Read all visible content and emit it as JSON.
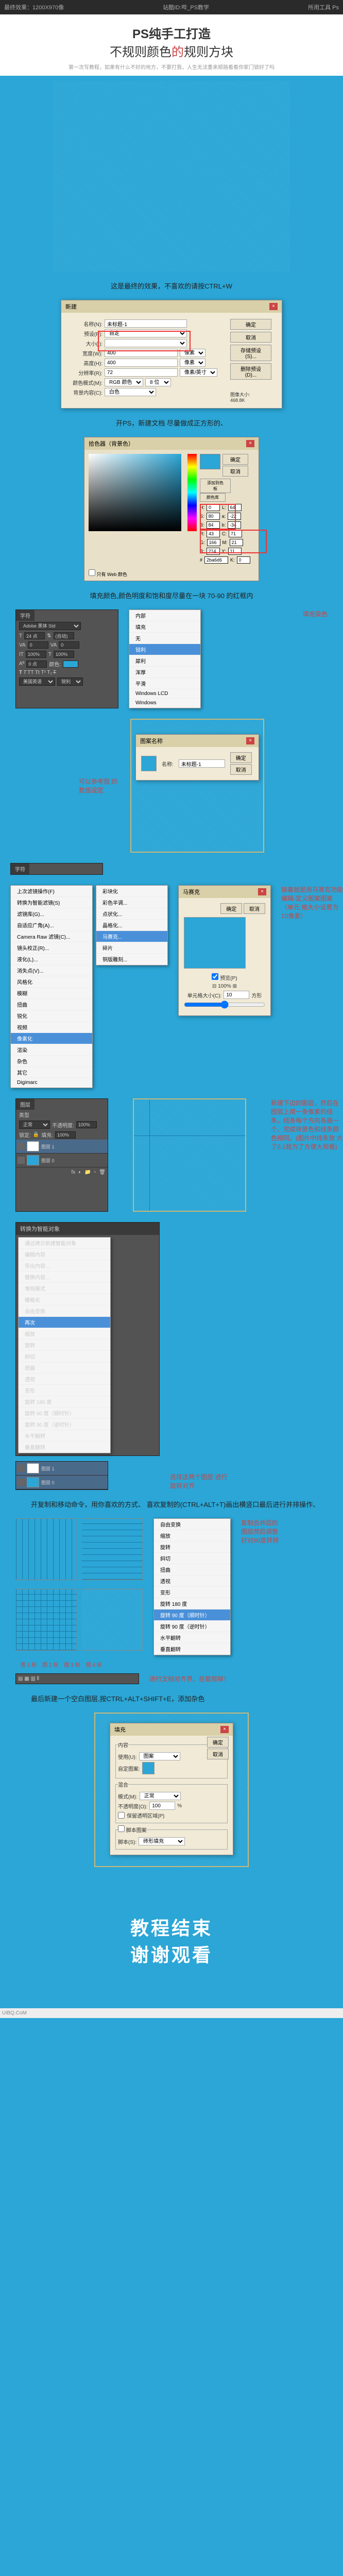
{
  "header": {
    "left": "最终效果：1200X970像",
    "mid": "站酷ID:哔_PS教学",
    "right": "所用工具 Ps"
  },
  "title": {
    "main": "PS纯手工打造",
    "sub1": "不规则颜色",
    "red": "的",
    "sub2": "规则方块",
    "note": "第一次写教程，如果有什么不好的地方，不要打我，人生无法重来顺路看看你家门锁好了吗"
  },
  "step1": {
    "caption": "这是最终的效果，不喜欢的请按CTRL+W"
  },
  "newdoc": {
    "title": "新建",
    "name_label": "名称(N):",
    "name_val": "未标题-1",
    "preset_label": "预设(P):",
    "preset_val": "自定",
    "size_label": "大小(I):",
    "width_label": "宽度(W):",
    "width_val": "400",
    "width_unit": "像素",
    "height_label": "高度(H):",
    "height_val": "400",
    "height_unit": "像素",
    "res_label": "分辨率(R):",
    "res_val": "72",
    "res_unit": "像素/英寸",
    "mode_label": "颜色模式(M):",
    "mode_val": "RGB 颜色",
    "bit": "8 位",
    "bg_label": "背景内容(C):",
    "bg_val": "白色",
    "ok": "确定",
    "cancel": "取消",
    "save": "存储预设(S)...",
    "del": "删除预设(D)...",
    "imgsize": "图像大小:",
    "imgsize_val": "468.8K"
  },
  "step2": {
    "caption": "开PS，新建文档 尽量做成正方形的、"
  },
  "picker": {
    "title": "拾色器（背景色）",
    "new": "新的",
    "cur": "当前",
    "only_web": "只有 Web 颜色",
    "ok": "确定",
    "cancel": "取消",
    "addlib": "添加到色板",
    "lib": "颜色库",
    "H": "H:",
    "Hv": "0",
    "S": "S:",
    "Sv": "80",
    "B": "B:",
    "Bv": "84",
    "Rl": "R:",
    "Rv": "43",
    "Gl": "G:",
    "Gv": "166",
    "b": "B:",
    "bv": "214",
    "L": "L:",
    "Lv": "64",
    "a": "a:",
    "av": "-22",
    "bb": "b:",
    "bbv": "-34",
    "hex": "#",
    "hexv": "2ba6d6",
    "C": "C:",
    "Cv": "71",
    "M": "M:",
    "Mv": "21",
    "Y": "Y:",
    "Yv": "11",
    "K": "K:",
    "Kv": "0"
  },
  "step3": {
    "caption": "填充颜色,颜色明度和饱和度尽量在一块 70-90 的红框内"
  },
  "fill_label": "填充染色",
  "char_panel": {
    "tab": "字符",
    "font": "Adobe 黑体 Std",
    "size": "24 点",
    "leading": "(自动)",
    "tracking": "0",
    "vscale": "100%",
    "hscale": "100%",
    "baseline": "0 点",
    "color": "颜色:",
    "lang": "美国英语",
    "aa": "锐利"
  },
  "menu_blend": {
    "items": [
      "内部",
      "填充",
      "无",
      "锐利",
      "犀利",
      "浑厚",
      "平滑",
      "Windows LCD",
      "Windows"
    ]
  },
  "step4": {
    "caption": "可以参考我\n的数值设定"
  },
  "pattern": {
    "title": "图案名称",
    "name_label": "名称:",
    "name_val": "未标题-1",
    "ok": "确定",
    "cancel": "取消"
  },
  "step5": {
    "caption": "接着就是用马赛克功能\n编辑-定义图案图案（单元\n格大小设置为10像素）"
  },
  "filters": {
    "items": [
      "上次滤镜操作(F)",
      "转换为智能滤镜(S)",
      "滤镜库(G)...",
      "自适应广角(A)...",
      "Camera Raw 滤镜(C)...",
      "镜头校正(R)...",
      "液化(L)...",
      "消失点(V)...",
      "风格化",
      "模糊",
      "扭曲",
      "锐化",
      "视频",
      "像素化",
      "渲染",
      "杂色",
      "其它",
      "Digimarc"
    ],
    "sub": [
      "彩块化",
      "彩色半调...",
      "点状化...",
      "晶格化...",
      "马赛克...",
      "碎片",
      "铜版雕刻..."
    ]
  },
  "mosaic": {
    "title": "马赛克",
    "ok": "确定",
    "cancel": "取消",
    "preview": "预览(P)",
    "cell": "单元格大小(C):",
    "cellv": "10",
    "unit": "方形"
  },
  "layers_panel": {
    "tab": "图层",
    "kind": "类型",
    "mode": "正常",
    "opacity_l": "不透明度:",
    "opacity": "100%",
    "lock": "锁定:",
    "fill_l": "填充:",
    "fill": "100%",
    "l1": "图层 1",
    "l0": "图层 0"
  },
  "step6": {
    "caption": "新建下边的图层，然后在\n图层上用一条像素的线\n条，线条每个方向各画一\n个、完成背景色和线条颜\n色相同。(图片中线条放\n大了0.1我为了方便大观看)"
  },
  "move_dialog": {
    "title": "转换为智能对象",
    "dup": "通过拷贝新建智能对象",
    "edit": "编辑内容",
    "exp": "导出内容...",
    "rep": "替换内容...",
    "stack": "堆栈模式",
    "rast": "栅格化",
    "free": "自由变换",
    "again": "再次",
    "scale": "缩放",
    "rot": "旋转",
    "skew": "斜切",
    "dist": "扭曲",
    "persp": "透视",
    "warp": "变形",
    "r180": "旋转 180 度",
    "r90cw": "旋转 90 度（顺时针）",
    "r90ccw": "旋转 90 度（逆时针）",
    "flipH": "水平翻转",
    "flipV": "垂直翻转"
  },
  "step7": {
    "caption": "选择这两个图层\n进行旋转对齐"
  },
  "step8": {
    "caption": "开复制和移动命令，用你喜欢的方式、\n喜欢复制的(CTRL+ALT+T)画出横竖口最后进行并排操作、"
  },
  "step9": {
    "caption": "复制合并后的\n图层然后调整\n好对90度转转"
  },
  "step10": {
    "caption": "进行文档对齐界、在裁剪掉！"
  },
  "markers": {
    "m1": "图 1 标",
    "m2": "图 2 标",
    "m3": "图 3 标",
    "m4": "图 4 标"
  },
  "fill_dialog": {
    "title": "填充",
    "content": "内容",
    "use_l": "使用(U):",
    "use_v": "图案",
    "pattern": "自定图案:",
    "blend": "混合",
    "mode_l": "模式(M):",
    "mode_v": "正常",
    "op_l": "不透明度(O):",
    "op_v": "100",
    "pct": "%",
    "trans": "保留透明区域(P)",
    "script": "脚本图案",
    "scr_l": "脚本(S):",
    "scr_v": "砖形填充",
    "ok": "确定",
    "cancel": "取消"
  },
  "step11": {
    "caption": "最后新建一个空白图层,按CTRL+ALT+SHIFT+E，添加杂色"
  },
  "end": {
    "l1": "教程结束",
    "l2": "谢谢观看"
  },
  "footer": "UiBQ.CoM"
}
